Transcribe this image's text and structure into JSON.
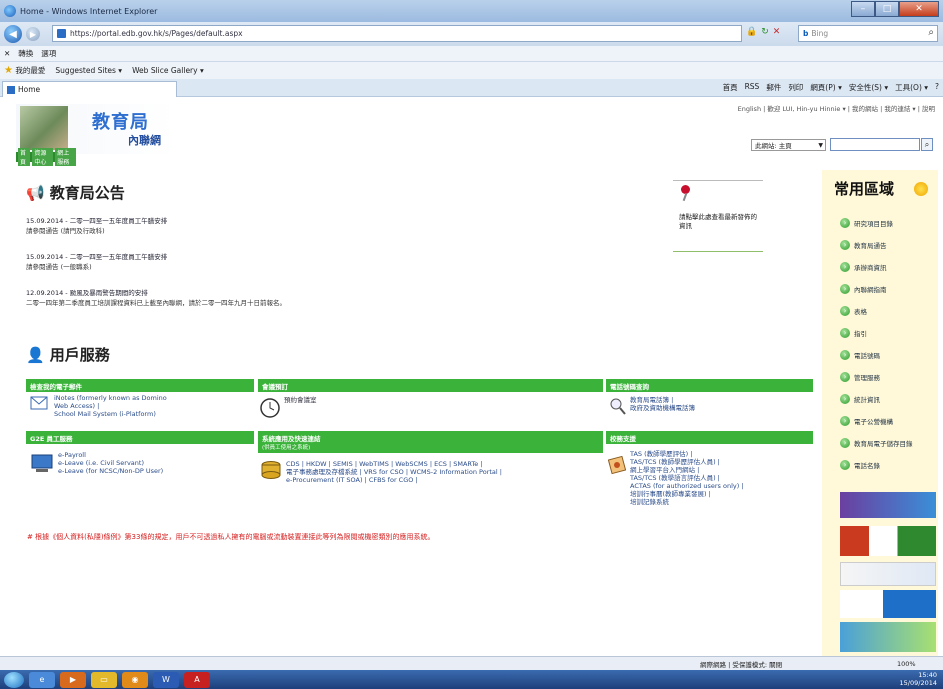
{
  "window": {
    "title": "Home - Windows Internet Explorer"
  },
  "address": {
    "url": "https://portal.edb.gov.hk/s/Pages/default.aspx",
    "search_engine": "Bing"
  },
  "cmdbar": {
    "items": [
      "轉換",
      "選項"
    ]
  },
  "favorites": {
    "label": "我的最愛",
    "suggested": "Suggested Sites ▾",
    "gallery": "Web Slice Gallery ▾"
  },
  "tab": {
    "label": "Home"
  },
  "tab_tools": [
    "首頁",
    "RSS",
    "郵件",
    "列印",
    "網頁(P) ▾",
    "安全性(S) ▾",
    "工具(O) ▾",
    "?"
  ],
  "portal": {
    "top_links": "English | 歡迎 LUI, Hin-yu Hinnie ▾ | 我的網站 | 我的連結 ▾ | 說明",
    "logo_title": "教育局",
    "logo_subtitle": "內聯網",
    "green_nav": [
      "首頁",
      "資源中心",
      "網上服務"
    ],
    "search_scope": "此網站: 主頁",
    "search_placeholder": ""
  },
  "announcements": {
    "heading": "教育局公告",
    "items": [
      {
        "date": "15.09.2014 - 二零一四至一五年度員工午膳安排",
        "sub": "請參閱通告 (請門及行政科)"
      },
      {
        "date": "15.09.2014 - 二零一四至一五年度員工午膳安排",
        "sub": "請參閱通告 (一般職系)"
      },
      {
        "date": "12.09.2014 - 颱風及暴雨警告期間的安排",
        "sub": "二零一四年第二季度員工培訓課程資料已上載至內聯網，請於二零一四年九月十日前報名。"
      }
    ]
  },
  "notice_box": {
    "text": "請點擊此處查看最新發佈的資訊"
  },
  "services": {
    "heading": "用戶服務",
    "sections": [
      {
        "head": "檢查我的電子郵件",
        "lines": [
          "iNotes (formerly known as Domino",
          "Web Access) |",
          "School Mail System (i-Platform)"
        ]
      },
      {
        "head": "會議預訂",
        "lines": [
          "預約會議室"
        ]
      },
      {
        "head": "電話號碼查詢",
        "lines": [
          "教育局電話簿 |",
          "政府及資助機構電話簿"
        ]
      },
      {
        "head": "G2E 員工服務",
        "lines": [
          "e-Payroll",
          "e-Leave (i.e. Civil Servant)",
          "e-Leave (for NCSC/Non-DP User)"
        ]
      },
      {
        "head": "系統應用及快速連結",
        "sub": "(供員工使用之系統)",
        "lines": [
          "CDS | HKDW | SEMIS | WebTIMS | WebSCMS | ECS | SMARTe |",
          "電子事務處理及存檔系統 | VRS for CSO | WCMS-2 Information Portal |",
          "e-Procurement (IT SOA) | CFBS for CGO |"
        ]
      },
      {
        "head": "校務支援",
        "lines": [
          "TAS (教師學歷評估) |",
          "TAS/TCS (教師學歷評估人員) |",
          "網上學習平台入門網站 |",
          "TAS/TCS (教學語言評估人員) |",
          "ACTAS (for authorized users only) |",
          "培訓行事曆(教師專業發展) |",
          "培訓記錄系統"
        ]
      }
    ]
  },
  "legal_note": "# 根據《個人資料(私隱)條例》第33條的規定，用戶不可透過私人擁有的電腦或流動裝置連接此等列為限閱或機密類別的應用系統。",
  "quick_links": {
    "heading": "常用區域",
    "items": [
      "研究項目目錄",
      "教育局通告",
      "承辦商資訊",
      "內聯網指南",
      "表格",
      "指引",
      "電話號碼",
      "管理服務",
      "統計資訊",
      "電子公營機構",
      "教育局電子儲存目錄",
      "電話名錄"
    ]
  },
  "status": {
    "zone": "網際網路 | 受保護模式: 關閉",
    "zoom": "100%"
  },
  "taskbar": {
    "time": "15:40",
    "date": "15/09/2014"
  }
}
